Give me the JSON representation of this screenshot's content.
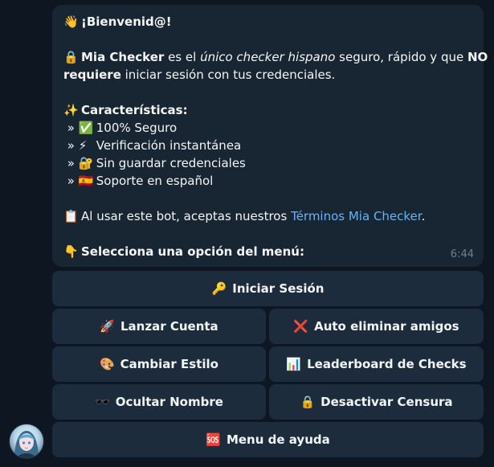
{
  "message": {
    "greeting_emoji": "👋",
    "greeting": "¡Bienvenid@!",
    "intro_emoji": "🔒",
    "intro_brand": "Mia Checker",
    "intro_text1": " es el ",
    "intro_italic": "único checker hispano",
    "intro_text2": " seguro, rápido y que ",
    "intro_bold_no": "NO",
    "intro_bold_requiere": "requiere",
    "intro_text3": " iniciar sesión con tus credenciales.",
    "features_emoji": "✨",
    "features_title": "Características:",
    "features": [
      {
        "emoji": "✅",
        "text": "100% Seguro"
      },
      {
        "emoji": "⚡",
        "text": "Verificación instantánea"
      },
      {
        "emoji": "🔐",
        "text": "Sin guardar credenciales"
      },
      {
        "emoji": "🇪🇸",
        "text": "Soporte en español"
      }
    ],
    "bullet": "»",
    "terms_emoji": "📋",
    "terms_text": "Al usar este bot, aceptas nuestros ",
    "terms_link": "Términos Mia Checker",
    "terms_end": ".",
    "select_emoji": "👇",
    "select_text": "Selecciona una opción del menú:",
    "time": "6:44"
  },
  "keyboard": {
    "login": {
      "emoji": "🔑",
      "label": "Iniciar Sesión"
    },
    "launch": {
      "emoji": "🚀",
      "label": "Lanzar Cuenta"
    },
    "auto_delete": {
      "emoji": "❌",
      "label": "Auto eliminar amigos"
    },
    "style": {
      "emoji": "🎨",
      "label": "Cambiar Estilo"
    },
    "leaderboard": {
      "emoji": "📊",
      "label": "Leaderboard de Checks"
    },
    "hide_name": {
      "emoji": "🕶️",
      "label": "Ocultar Nombre"
    },
    "censorship": {
      "emoji": "🔒",
      "label": "Desactivar Censura"
    },
    "help": {
      "emoji": "🆘",
      "label": "Menu de ayuda"
    }
  }
}
